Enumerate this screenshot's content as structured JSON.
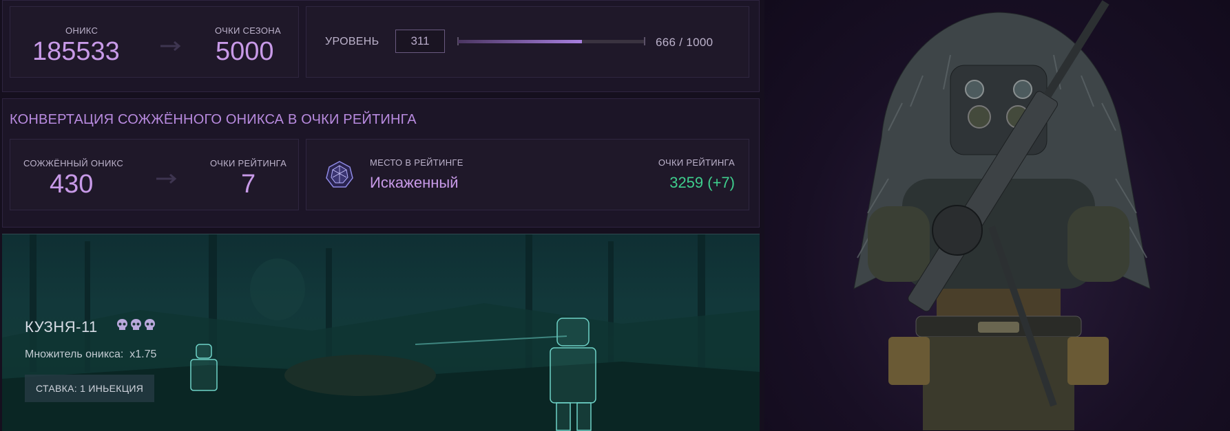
{
  "season": {
    "onyx_label": "ОНИКС",
    "onyx_value": "185533",
    "season_points_label": "ОЧКИ СЕЗОНА",
    "season_points_value": "5000",
    "level_label": "УРОВЕНЬ",
    "level_value": "311",
    "progress_text": "666 / 1000",
    "progress_fraction": 0.666
  },
  "conversion": {
    "title": "КОНВЕРТАЦИЯ СОЖЖЁННОГО ОНИКСА В ОЧКИ РЕЙТИНГА",
    "burned_label": "СОЖЖЁННЫЙ ОНИКС",
    "burned_value": "430",
    "rating_points_label": "ОЧКИ РЕЙТИНГА",
    "rating_points_value": "7",
    "rank_label": "МЕСТО В РЕЙТИНГЕ",
    "rank_value": "Искаженный",
    "rank_points_label": "ОЧКИ РЕЙТИНГА",
    "rank_points_value": "3259 (+7)",
    "rank_icon": "crystal-icon"
  },
  "mission": {
    "name": "КУЗНЯ-11",
    "difficulty_icon": "skull-icon",
    "difficulty_count": 3,
    "multiplier_text": "Множитель оникса:  x1.75",
    "bet_button": "СТАВКА: 1 ИНЬЕКЦИЯ"
  },
  "colors": {
    "accent": "#c89ae8",
    "positive": "#3fcf8e",
    "background": "#150f1e"
  }
}
